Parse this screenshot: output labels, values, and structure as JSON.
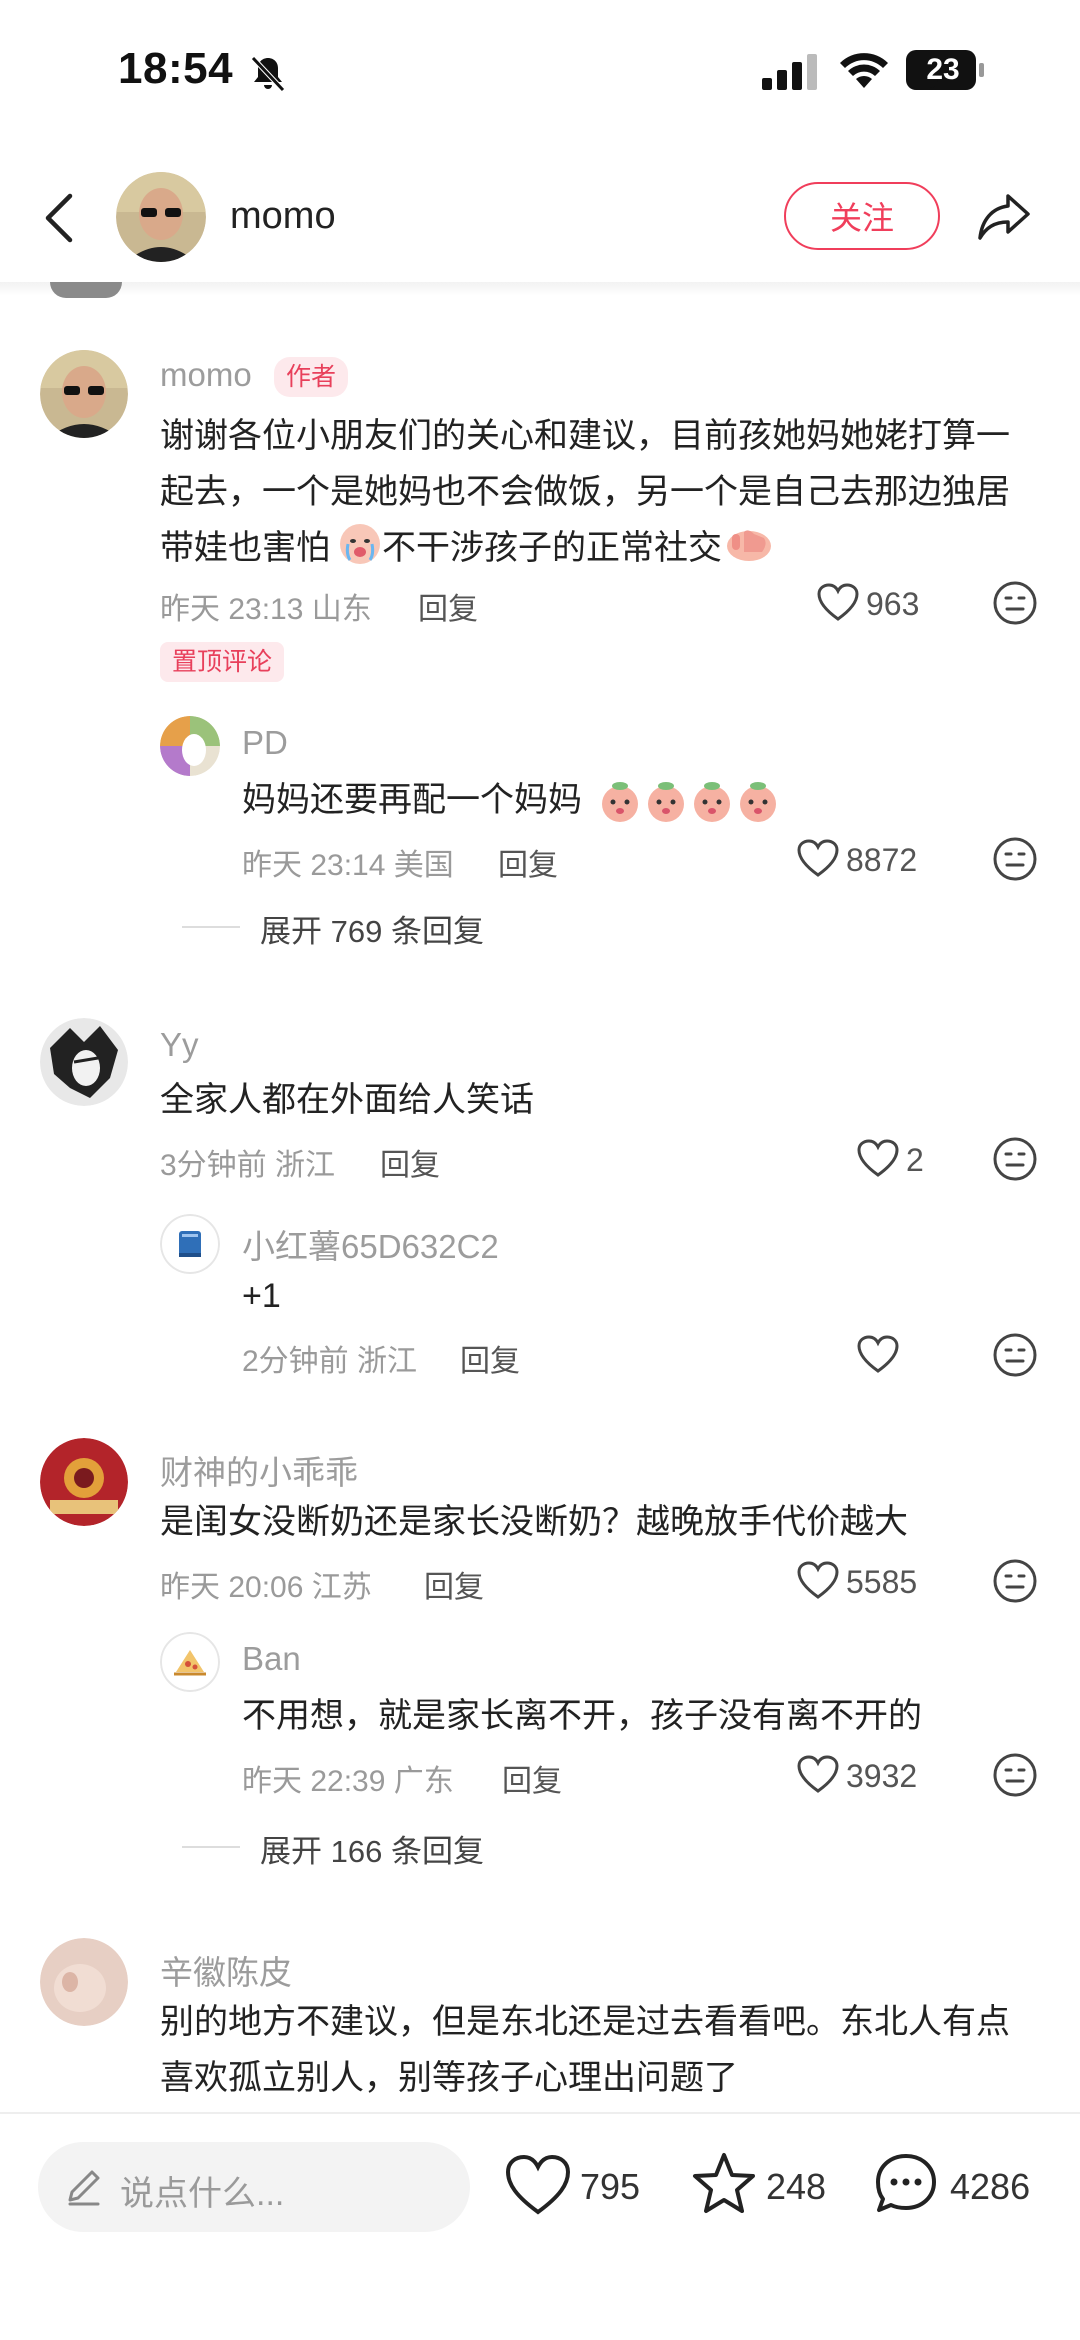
{
  "status": {
    "time": "18:54",
    "battery": "23"
  },
  "header": {
    "username": "momo",
    "follow_label": "关注"
  },
  "comments": [
    {
      "username": "momo",
      "badge": "作者",
      "text_lines": [
        "谢谢各位小朋友们的关心和建议，目前孩她妈她姥打算一",
        "起去，一个是她妈也不会做饭，另一个是自己去那边独居",
        "带娃也害怕",
        "不干涉孩子的正常社交"
      ],
      "time_loc": "昨天 23:13 山东",
      "reply": "回复",
      "likes": "963",
      "pin": "置顶评论",
      "replies": [
        {
          "username": "PD",
          "text": "妈妈还要再配一个妈妈",
          "time_loc": "昨天 23:14 美国",
          "reply": "回复",
          "likes": "8872"
        }
      ],
      "expand": "展开 769 条回复"
    },
    {
      "username": "Yy",
      "text": "全家人都在外面给人笑话",
      "time_loc": "3分钟前 浙江",
      "reply": "回复",
      "likes": "2",
      "replies": [
        {
          "username": "小红薯65D632C2",
          "text": "+1",
          "time_loc": "2分钟前 浙江",
          "reply": "回复",
          "likes": ""
        }
      ]
    },
    {
      "username": "财神的小乖乖",
      "text": "是闺女没断奶还是家长没断奶？越晚放手代价越大",
      "time_loc": "昨天 20:06 江苏",
      "reply": "回复",
      "likes": "5585",
      "replies": [
        {
          "username": "Ban",
          "text": "不用想，就是家长离不开，孩子没有离不开的",
          "time_loc": "昨天 22:39 广东",
          "reply": "回复",
          "likes": "3932"
        }
      ],
      "expand": "展开 166 条回复"
    },
    {
      "username": "辛徽陈皮",
      "text_lines": [
        "别的地方不建议，但是东北还是过去看看吧。东北人有点",
        "喜欢孤立别人，别等孩子心理出问题了"
      ]
    }
  ],
  "bottom_bar": {
    "placeholder": "说点什么...",
    "likes": "795",
    "stars": "248",
    "comments": "4286"
  },
  "icons": [
    "bell-slash-icon",
    "signal-icon",
    "wifi-icon",
    "battery-icon",
    "back-arrow-icon",
    "share-icon",
    "heart-icon",
    "neutral-face-icon",
    "pencil-icon",
    "star-icon",
    "chat-bubble-icon"
  ],
  "colors": {
    "accent": "#f03e5b",
    "badge_bg": "#fde9ec",
    "muted_text": "#9a9a9a"
  }
}
